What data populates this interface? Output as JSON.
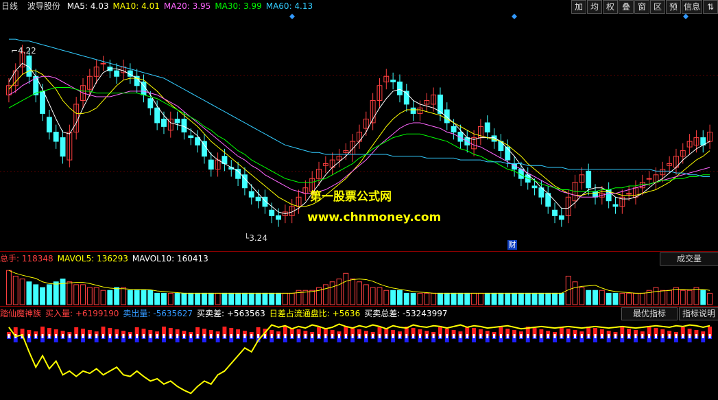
{
  "header": {
    "period": "日线",
    "stock_name": "波导股份",
    "ma": [
      {
        "label": "MA5: 4.03",
        "color": "#ffffff"
      },
      {
        "label": "MA10: 4.01",
        "color": "#ffff00"
      },
      {
        "label": "MA20: 3.95",
        "color": "#ff66ff"
      },
      {
        "label": "MA30: 3.99",
        "color": "#00ff00"
      },
      {
        "label": "MA60: 4.13",
        "color": "#33ccff"
      }
    ],
    "buttons": [
      "加",
      "均",
      "权",
      "叠",
      "窗",
      "区",
      "预",
      "信息"
    ],
    "menu_icon": "up-down-arrow-icon"
  },
  "price_panel": {
    "high_label": "4.22",
    "low_label": "3.24",
    "finance_marker": "财"
  },
  "watermark": {
    "line1": "第一股票公式网",
    "line2": "www.chnmoney.com"
  },
  "volume_panel": {
    "labels": [
      {
        "label": "总手: 118348",
        "color": "#ff4040"
      },
      {
        "label": "MAVOL5: 136293",
        "color": "#ffff00"
      },
      {
        "label": "MAVOL10: 160413",
        "color": "#ffffff"
      }
    ],
    "button": "成交量"
  },
  "indicator_panel": {
    "labels": [
      {
        "label": "踏仙魔神族",
        "color": "#ff4040"
      },
      {
        "label": "买入量: +6199190",
        "color": "#ff4040"
      },
      {
        "label": "卖出量: -5635627",
        "color": "#3399ff"
      },
      {
        "label": "买卖差: +563563",
        "color": "#ffffff"
      },
      {
        "label": "日差占流通盘比: +5636",
        "color": "#ffff00"
      },
      {
        "label": "买卖总差: -53243997",
        "color": "#ffffff"
      }
    ],
    "buttons": [
      "最优指标",
      "指标说明"
    ]
  },
  "chart_data": {
    "type": "candlestick",
    "colors": {
      "up": "#ff4040",
      "down": "#40ffff",
      "ma5": "#ffffff",
      "ma10": "#ffff00",
      "ma20": "#ff66ff",
      "ma30": "#00ff00",
      "ma60": "#33ccff",
      "vol_up": "#ff4040",
      "vol_down": "#40ffff",
      "buy": "#ff2020",
      "sell": "#2020ff",
      "total": "#ffff00"
    },
    "ylim": [
      3.15,
      4.35
    ],
    "close": [
      4.0,
      4.08,
      4.18,
      4.05,
      3.95,
      3.85,
      3.75,
      3.7,
      3.62,
      3.75,
      3.9,
      4.0,
      4.05,
      4.1,
      4.12,
      4.08,
      4.05,
      4.1,
      4.05,
      4.0,
      3.95,
      3.88,
      3.8,
      3.78,
      3.82,
      3.8,
      3.75,
      3.72,
      3.68,
      3.62,
      3.55,
      3.6,
      3.58,
      3.55,
      3.5,
      3.45,
      3.4,
      3.38,
      3.35,
      3.3,
      3.28,
      3.32,
      3.35,
      3.4,
      3.45,
      3.5,
      3.55,
      3.58,
      3.6,
      3.62,
      3.65,
      3.7,
      3.75,
      3.82,
      3.92,
      4.0,
      4.05,
      4.02,
      3.95,
      3.9,
      3.85,
      3.88,
      3.92,
      3.95,
      3.85,
      3.8,
      3.75,
      3.7,
      3.68,
      3.72,
      3.78,
      3.75,
      3.7,
      3.65,
      3.6,
      3.55,
      3.5,
      3.48,
      3.45,
      3.4,
      3.35,
      3.3,
      3.28,
      3.4,
      3.48,
      3.52,
      3.45,
      3.4,
      3.42,
      3.38,
      3.35,
      3.4,
      3.42,
      3.45,
      3.48,
      3.5,
      3.52,
      3.55,
      3.58,
      3.62,
      3.65,
      3.7,
      3.72,
      3.68,
      3.75
    ],
    "ma5": [
      4.02,
      4.08,
      4.12,
      4.1,
      4.05,
      3.98,
      3.9,
      3.82,
      3.75,
      3.74,
      3.8,
      3.88,
      3.95,
      4.02,
      4.07,
      4.09,
      4.09,
      4.08,
      4.06,
      4.04,
      4.0,
      3.95,
      3.89,
      3.84,
      3.8,
      3.79,
      3.78,
      3.76,
      3.73,
      3.68,
      3.63,
      3.6,
      3.58,
      3.56,
      3.54,
      3.5,
      3.46,
      3.42,
      3.38,
      3.35,
      3.32,
      3.31,
      3.32,
      3.34,
      3.37,
      3.42,
      3.47,
      3.52,
      3.56,
      3.59,
      3.62,
      3.66,
      3.7,
      3.75,
      3.82,
      3.88,
      3.93,
      3.97,
      3.98,
      3.96,
      3.92,
      3.9,
      3.89,
      3.88,
      3.86,
      3.83,
      3.8,
      3.76,
      3.72,
      3.71,
      3.72,
      3.72,
      3.72,
      3.7,
      3.66,
      3.62,
      3.57,
      3.52,
      3.49,
      3.45,
      3.42,
      3.38,
      3.34,
      3.34,
      3.37,
      3.41,
      3.44,
      3.45,
      3.45,
      3.43,
      3.4,
      3.39,
      3.39,
      3.4,
      3.42,
      3.45,
      3.48,
      3.5,
      3.53,
      3.56,
      3.6,
      3.63,
      3.66,
      3.68,
      3.7
    ],
    "ma10": [
      3.98,
      4.02,
      4.06,
      4.08,
      4.08,
      4.06,
      4.02,
      3.98,
      3.92,
      3.88,
      3.85,
      3.85,
      3.86,
      3.88,
      3.92,
      3.96,
      4.0,
      4.03,
      4.04,
      4.04,
      4.03,
      4.0,
      3.97,
      3.93,
      3.9,
      3.87,
      3.84,
      3.81,
      3.78,
      3.74,
      3.7,
      3.67,
      3.64,
      3.61,
      3.58,
      3.55,
      3.52,
      3.49,
      3.46,
      3.43,
      3.4,
      3.38,
      3.36,
      3.35,
      3.35,
      3.36,
      3.38,
      3.41,
      3.44,
      3.47,
      3.5,
      3.54,
      3.58,
      3.63,
      3.68,
      3.73,
      3.78,
      3.82,
      3.85,
      3.87,
      3.87,
      3.87,
      3.86,
      3.85,
      3.84,
      3.82,
      3.8,
      3.78,
      3.76,
      3.74,
      3.73,
      3.72,
      3.71,
      3.7,
      3.68,
      3.65,
      3.62,
      3.58,
      3.55,
      3.52,
      3.49,
      3.46,
      3.44,
      3.42,
      3.41,
      3.41,
      3.42,
      3.42,
      3.43,
      3.43,
      3.42,
      3.41,
      3.41,
      3.41,
      3.42,
      3.43,
      3.44,
      3.46,
      3.48,
      3.51,
      3.54,
      3.57,
      3.6,
      3.62,
      3.65
    ],
    "ma20": [
      3.95,
      3.97,
      4.0,
      4.02,
      4.04,
      4.05,
      4.05,
      4.04,
      4.02,
      4.0,
      3.98,
      3.96,
      3.95,
      3.94,
      3.94,
      3.94,
      3.95,
      3.96,
      3.97,
      3.97,
      3.97,
      3.96,
      3.95,
      3.93,
      3.91,
      3.89,
      3.86,
      3.83,
      3.8,
      3.77,
      3.74,
      3.71,
      3.68,
      3.65,
      3.62,
      3.6,
      3.57,
      3.55,
      3.52,
      3.5,
      3.48,
      3.46,
      3.44,
      3.43,
      3.42,
      3.42,
      3.43,
      3.44,
      3.46,
      3.48,
      3.51,
      3.54,
      3.57,
      3.6,
      3.64,
      3.68,
      3.71,
      3.74,
      3.77,
      3.79,
      3.8,
      3.8,
      3.79,
      3.78,
      3.77,
      3.75,
      3.74,
      3.72,
      3.7,
      3.68,
      3.67,
      3.65,
      3.63,
      3.61,
      3.59,
      3.57,
      3.55,
      3.53,
      3.51,
      3.49,
      3.47,
      3.45,
      3.43,
      3.42,
      3.41,
      3.4,
      3.4,
      3.4,
      3.41,
      3.42,
      3.42,
      3.43,
      3.44,
      3.45,
      3.46,
      3.47,
      3.48,
      3.49,
      3.5,
      3.51,
      3.52,
      3.53,
      3.54,
      3.55,
      3.56
    ],
    "ma30": [
      3.88,
      3.9,
      3.92,
      3.94,
      3.96,
      3.97,
      3.98,
      3.99,
      3.99,
      3.99,
      3.98,
      3.97,
      3.97,
      3.96,
      3.96,
      3.96,
      3.96,
      3.96,
      3.96,
      3.96,
      3.95,
      3.94,
      3.93,
      3.91,
      3.89,
      3.87,
      3.85,
      3.83,
      3.81,
      3.78,
      3.76,
      3.73,
      3.71,
      3.68,
      3.65,
      3.63,
      3.6,
      3.58,
      3.56,
      3.54,
      3.52,
      3.5,
      3.49,
      3.48,
      3.48,
      3.48,
      3.49,
      3.5,
      3.52,
      3.54,
      3.56,
      3.58,
      3.61,
      3.63,
      3.66,
      3.68,
      3.7,
      3.72,
      3.73,
      3.74,
      3.74,
      3.74,
      3.73,
      3.72,
      3.71,
      3.7,
      3.68,
      3.66,
      3.65,
      3.63,
      3.62,
      3.6,
      3.59,
      3.57,
      3.55,
      3.54,
      3.52,
      3.5,
      3.49,
      3.47,
      3.46,
      3.45,
      3.44,
      3.44,
      3.43,
      3.43,
      3.43,
      3.43,
      3.44,
      3.44,
      3.45,
      3.45,
      3.46,
      3.46,
      3.47,
      3.47,
      3.48,
      3.49,
      3.49,
      3.5,
      3.5,
      3.51,
      3.51,
      3.52,
      3.52
    ],
    "ma60": [
      4.25,
      4.25,
      4.24,
      4.24,
      4.23,
      4.22,
      4.21,
      4.2,
      4.19,
      4.18,
      4.17,
      4.16,
      4.15,
      4.14,
      4.13,
      4.12,
      4.11,
      4.1,
      4.09,
      4.08,
      4.07,
      4.06,
      4.05,
      4.04,
      4.02,
      4.0,
      3.98,
      3.96,
      3.94,
      3.92,
      3.9,
      3.88,
      3.86,
      3.84,
      3.82,
      3.8,
      3.78,
      3.76,
      3.74,
      3.72,
      3.7,
      3.68,
      3.67,
      3.66,
      3.65,
      3.64,
      3.64,
      3.63,
      3.63,
      3.63,
      3.63,
      3.63,
      3.63,
      3.63,
      3.63,
      3.63,
      3.63,
      3.62,
      3.62,
      3.62,
      3.62,
      3.62,
      3.61,
      3.61,
      3.61,
      3.61,
      3.61,
      3.6,
      3.6,
      3.6,
      3.6,
      3.59,
      3.59,
      3.59,
      3.58,
      3.58,
      3.58,
      3.57,
      3.57,
      3.57,
      3.56,
      3.56,
      3.56,
      3.55,
      3.55,
      3.55,
      3.55,
      3.55,
      3.55,
      3.55,
      3.55,
      3.55,
      3.55,
      3.55,
      3.55,
      3.55,
      3.54,
      3.54,
      3.54,
      3.53,
      3.53,
      3.52,
      3.52,
      3.51,
      3.51
    ],
    "volume": [
      12,
      10,
      9,
      8,
      7,
      6,
      7,
      8,
      9,
      8,
      7,
      7,
      6,
      6,
      5,
      5,
      6,
      6,
      5,
      5,
      5,
      5,
      4,
      4,
      4,
      4,
      4,
      4,
      4,
      4,
      4,
      4,
      4,
      4,
      4,
      4,
      4,
      4,
      4,
      4,
      4,
      4,
      4,
      5,
      5,
      5,
      6,
      7,
      8,
      9,
      11,
      9,
      8,
      7,
      6,
      6,
      5,
      5,
      5,
      4,
      4,
      4,
      4,
      4,
      4,
      4,
      4,
      4,
      4,
      4,
      4,
      4,
      4,
      4,
      4,
      4,
      4,
      4,
      4,
      4,
      4,
      4,
      4,
      10,
      8,
      6,
      5,
      5,
      5,
      4,
      4,
      4,
      4,
      4,
      4,
      5,
      6,
      5,
      5,
      6,
      5,
      5,
      6,
      5,
      4
    ],
    "total_diff": [
      0.92,
      0.8,
      0.82,
      0.6,
      0.4,
      0.55,
      0.38,
      0.48,
      0.3,
      0.35,
      0.28,
      0.35,
      0.32,
      0.38,
      0.3,
      0.35,
      0.4,
      0.3,
      0.28,
      0.35,
      0.28,
      0.22,
      0.25,
      0.18,
      0.22,
      0.15,
      0.1,
      0.06,
      0.15,
      0.22,
      0.18,
      0.3,
      0.35,
      0.45,
      0.55,
      0.65,
      0.6,
      0.75,
      0.85,
      0.95,
      0.92,
      0.94,
      0.9,
      0.93,
      0.91,
      0.95,
      0.93,
      0.9,
      0.92,
      0.96,
      0.93,
      0.91,
      0.94,
      0.92,
      0.95,
      0.93,
      0.9,
      0.94,
      0.92,
      0.91,
      0.95,
      0.93,
      0.92,
      0.94,
      0.93,
      0.91,
      0.93,
      0.95,
      0.92,
      0.94,
      0.93,
      0.91,
      0.92,
      0.93,
      0.94,
      0.92,
      0.9,
      0.91,
      0.92,
      0.93,
      0.92,
      0.91,
      0.92,
      0.93,
      0.92,
      0.91,
      0.92,
      0.93,
      0.92,
      0.91,
      0.92,
      0.93,
      0.92,
      0.91,
      0.92,
      0.93,
      0.94,
      0.93,
      0.92,
      0.94,
      0.93,
      0.95,
      0.94,
      0.92,
      0.94
    ]
  }
}
